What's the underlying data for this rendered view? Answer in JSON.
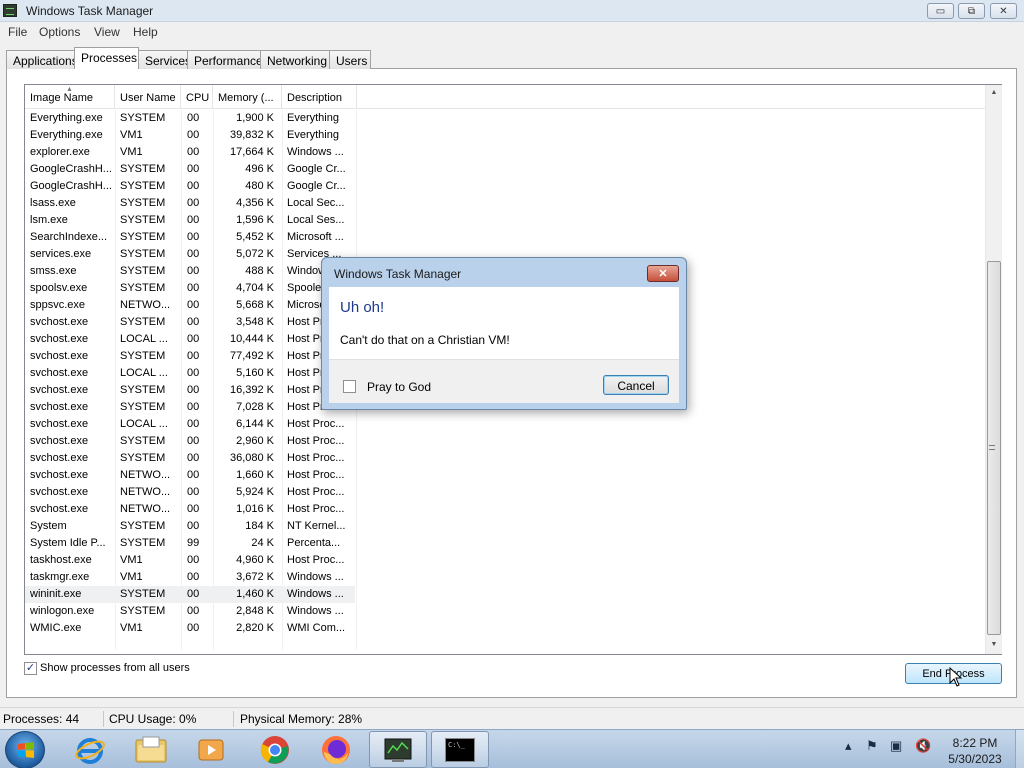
{
  "window": {
    "title": "Windows Task Manager",
    "minimize_glyph": "▭",
    "maximize_glyph": "⧉",
    "close_glyph": "✕"
  },
  "menu": [
    "File",
    "Options",
    "View",
    "Help"
  ],
  "tabs": [
    "Applications",
    "Processes",
    "Services",
    "Performance",
    "Networking",
    "Users"
  ],
  "active_tab": "Processes",
  "columns": [
    "Image Name",
    "User Name",
    "CPU",
    "Memory (...",
    "Description"
  ],
  "processes": [
    {
      "name": "Everything.exe",
      "user": "SYSTEM",
      "cpu": "00",
      "mem": "1,900 K",
      "desc": "Everything"
    },
    {
      "name": "Everything.exe",
      "user": "VM1",
      "cpu": "00",
      "mem": "39,832 K",
      "desc": "Everything"
    },
    {
      "name": "explorer.exe",
      "user": "VM1",
      "cpu": "00",
      "mem": "17,664 K",
      "desc": "Windows ..."
    },
    {
      "name": "GoogleCrashH...",
      "user": "SYSTEM",
      "cpu": "00",
      "mem": "496 K",
      "desc": "Google Cr..."
    },
    {
      "name": "GoogleCrashH...",
      "user": "SYSTEM",
      "cpu": "00",
      "mem": "480 K",
      "desc": "Google Cr..."
    },
    {
      "name": "lsass.exe",
      "user": "SYSTEM",
      "cpu": "00",
      "mem": "4,356 K",
      "desc": "Local Sec..."
    },
    {
      "name": "lsm.exe",
      "user": "SYSTEM",
      "cpu": "00",
      "mem": "1,596 K",
      "desc": "Local Ses..."
    },
    {
      "name": "SearchIndexe...",
      "user": "SYSTEM",
      "cpu": "00",
      "mem": "5,452 K",
      "desc": "Microsoft ..."
    },
    {
      "name": "services.exe",
      "user": "SYSTEM",
      "cpu": "00",
      "mem": "5,072 K",
      "desc": "Services ..."
    },
    {
      "name": "smss.exe",
      "user": "SYSTEM",
      "cpu": "00",
      "mem": "488 K",
      "desc": "Window..."
    },
    {
      "name": "spoolsv.exe",
      "user": "SYSTEM",
      "cpu": "00",
      "mem": "4,704 K",
      "desc": "Spooler..."
    },
    {
      "name": "sppsvc.exe",
      "user": "NETWO...",
      "cpu": "00",
      "mem": "5,668 K",
      "desc": "Microso..."
    },
    {
      "name": "svchost.exe",
      "user": "SYSTEM",
      "cpu": "00",
      "mem": "3,548 K",
      "desc": "Host Pr..."
    },
    {
      "name": "svchost.exe",
      "user": "LOCAL ...",
      "cpu": "00",
      "mem": "10,444 K",
      "desc": "Host Pr..."
    },
    {
      "name": "svchost.exe",
      "user": "SYSTEM",
      "cpu": "00",
      "mem": "77,492 K",
      "desc": "Host Pr..."
    },
    {
      "name": "svchost.exe",
      "user": "LOCAL ...",
      "cpu": "00",
      "mem": "5,160 K",
      "desc": "Host Pr..."
    },
    {
      "name": "svchost.exe",
      "user": "SYSTEM",
      "cpu": "00",
      "mem": "16,392 K",
      "desc": "Host Pr..."
    },
    {
      "name": "svchost.exe",
      "user": "SYSTEM",
      "cpu": "00",
      "mem": "7,028 K",
      "desc": "Host Proc..."
    },
    {
      "name": "svchost.exe",
      "user": "LOCAL ...",
      "cpu": "00",
      "mem": "6,144 K",
      "desc": "Host Proc..."
    },
    {
      "name": "svchost.exe",
      "user": "SYSTEM",
      "cpu": "00",
      "mem": "2,960 K",
      "desc": "Host Proc..."
    },
    {
      "name": "svchost.exe",
      "user": "SYSTEM",
      "cpu": "00",
      "mem": "36,080 K",
      "desc": "Host Proc..."
    },
    {
      "name": "svchost.exe",
      "user": "NETWO...",
      "cpu": "00",
      "mem": "1,660 K",
      "desc": "Host Proc..."
    },
    {
      "name": "svchost.exe",
      "user": "NETWO...",
      "cpu": "00",
      "mem": "5,924 K",
      "desc": "Host Proc..."
    },
    {
      "name": "svchost.exe",
      "user": "NETWO...",
      "cpu": "00",
      "mem": "1,016 K",
      "desc": "Host Proc..."
    },
    {
      "name": "System",
      "user": "SYSTEM",
      "cpu": "00",
      "mem": "184 K",
      "desc": "NT Kernel..."
    },
    {
      "name": "System Idle P...",
      "user": "SYSTEM",
      "cpu": "99",
      "mem": "24 K",
      "desc": "Percenta..."
    },
    {
      "name": "taskhost.exe",
      "user": "VM1",
      "cpu": "00",
      "mem": "4,960 K",
      "desc": "Host Proc..."
    },
    {
      "name": "taskmgr.exe",
      "user": "VM1",
      "cpu": "00",
      "mem": "3,672 K",
      "desc": "Windows ..."
    },
    {
      "name": "wininit.exe",
      "user": "SYSTEM",
      "cpu": "00",
      "mem": "1,460 K",
      "desc": "Windows ...",
      "selected": true
    },
    {
      "name": "winlogon.exe",
      "user": "SYSTEM",
      "cpu": "00",
      "mem": "2,848 K",
      "desc": "Windows ..."
    },
    {
      "name": "WMIC.exe",
      "user": "VM1",
      "cpu": "00",
      "mem": "2,820 K",
      "desc": "WMI Com..."
    }
  ],
  "show_all_users": {
    "label": "Show processes from all users",
    "checked": true
  },
  "end_process_label": "End Process",
  "status": {
    "processes": "Processes: 44",
    "cpu": "CPU Usage: 0%",
    "memory": "Physical Memory: 28%"
  },
  "dialog": {
    "title": "Windows Task Manager",
    "heading": "Uh oh!",
    "message": "Can't do that on a Christian VM!",
    "checkbox_label": "Pray to God",
    "cancel_label": "Cancel",
    "close_glyph": "✕"
  },
  "taskbar": {
    "apps": [
      "internet-explorer",
      "file-explorer",
      "media-player",
      "chrome",
      "firefox",
      "task-manager",
      "command-prompt"
    ],
    "cmd_label": "C:\\_",
    "time": "8:22 PM",
    "date": "5/30/2023"
  },
  "colors": {
    "dialog_heading": "#1e3a8a",
    "selection": "#eef0f2",
    "taskbar": "#b4c9e2"
  }
}
